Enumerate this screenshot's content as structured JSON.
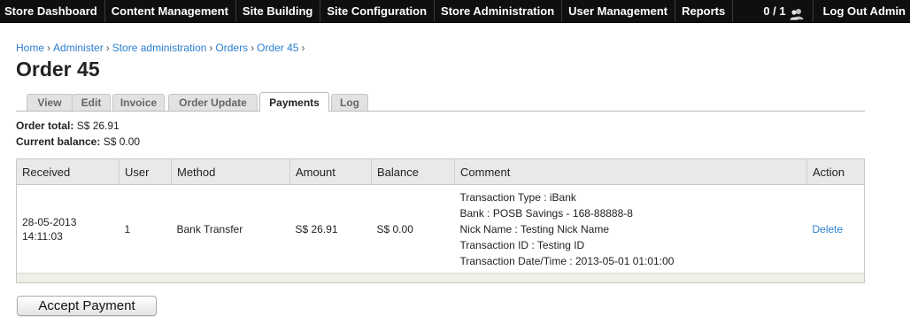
{
  "topbar": {
    "menu": [
      "Store Dashboard",
      "Content Management",
      "Site Building",
      "Site Configuration",
      "Store Administration",
      "User Management",
      "Reports"
    ],
    "user_count": "0 / 1",
    "user_icon": "users-icon",
    "logout": "Log Out Admin"
  },
  "breadcrumb": [
    "Home",
    "Administer",
    "Store administration",
    "Orders",
    "Order 45"
  ],
  "breadcrumb_separator": "›",
  "page_title": "Order 45",
  "tabs": [
    "View",
    "Edit",
    "Invoice",
    "Order Update",
    "Payments",
    "Log"
  ],
  "active_tab": "Payments",
  "totals": {
    "order_total_label": "Order total:",
    "order_total_value": "S$ 26.91",
    "current_balance_label": "Current balance:",
    "current_balance_value": "S$ 0.00"
  },
  "payments_table": {
    "headers": [
      "Received",
      "User",
      "Method",
      "Amount",
      "Balance",
      "Comment",
      "Action"
    ],
    "rows": [
      {
        "received_date": "28-05-2013",
        "received_time": "14:11:03",
        "user": "1",
        "method": "Bank Transfer",
        "amount": "S$ 26.91",
        "balance": "S$ 0.00",
        "comment": [
          "Transaction Type : iBank",
          "Bank : POSB Savings - 168-88888-8",
          "Nick Name : Testing Nick Name",
          "Transaction ID : Testing ID",
          "Transaction Date/Time : 2013-05-01 01:01:00"
        ],
        "action": "Delete"
      }
    ]
  },
  "accept_button": "Accept Payment",
  "colors": {
    "topbar_bg": "#0f0f0f",
    "link": "#2b7fd0",
    "table_header_bg": "#e9e9e9",
    "table_footer_bg": "#efefe8"
  }
}
